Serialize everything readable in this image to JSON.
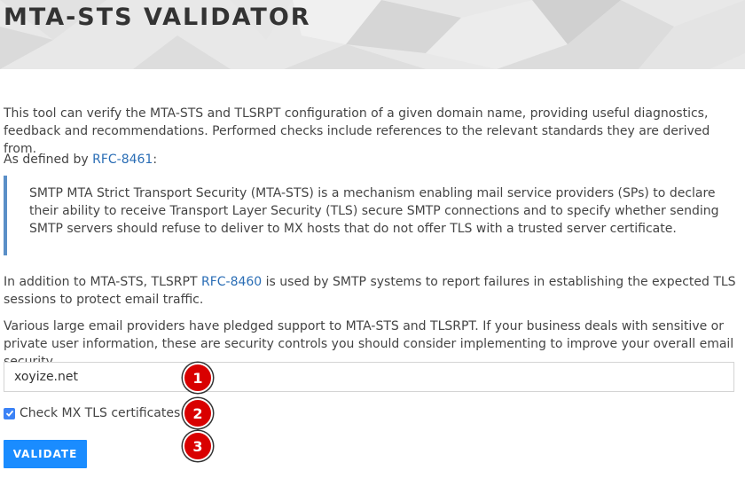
{
  "header": {
    "title": "MTA-STS VALIDATOR"
  },
  "intro": {
    "text": "This tool can verify the MTA-STS and TLSRPT configuration of a given domain name, providing useful diagnostics, feedback and recommendations. Performed checks include references to the relevant standards they are derived from.",
    "defined_prefix": "As defined by ",
    "defined_link": "RFC-8461",
    "defined_suffix": ":"
  },
  "quote": {
    "text": "SMTP MTA Strict Transport Security (MTA-STS) is a mechanism enabling mail service providers (SPs) to declare their ability to receive Transport Layer Security (TLS) secure SMTP connections and to specify whether sending SMTP servers should refuse to deliver to MX hosts that do not offer TLS with a trusted server certificate."
  },
  "tlsrpt": {
    "prefix": "In addition to MTA-STS, TLSRPT ",
    "link": "RFC-8460",
    "suffix": " is used by SMTP systems to report failures in establishing the expected TLS sessions to protect email traffic."
  },
  "providers": {
    "text": "Various large email providers have pledged support to MTA-STS and TLSRPT. If your business deals with sensitive or private user information, these are security controls you should consider implementing to improve your overall email security."
  },
  "form": {
    "domain_value": "xoyize.net",
    "check_mx_label": "Check MX TLS certificates",
    "check_mx_checked": true,
    "validate_label": "VALIDATE"
  },
  "markers": [
    "1",
    "2",
    "3"
  ],
  "colors": {
    "accent": "#1a8cff",
    "link": "#2a6db5",
    "quote_border": "#5a8fc7",
    "marker": "#d90000"
  }
}
